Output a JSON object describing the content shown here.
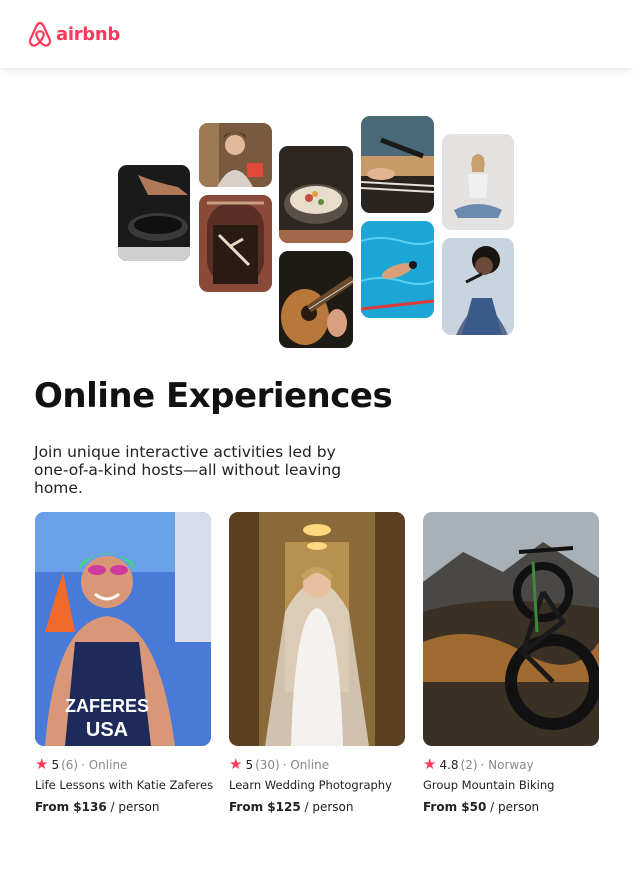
{
  "brand": {
    "name": "airbnb",
    "color": "#ff385c",
    "logo_icon": "airbnb-belo-icon"
  },
  "hero": {
    "heading": "Online Experiences",
    "subtitle": "Join unique interactive activities led by one-of-a-kind hosts—all without leaving home."
  },
  "gallery": [
    {
      "name": "cooking-pan-photo"
    },
    {
      "name": "woman-portrait-photo"
    },
    {
      "name": "dancer-doorway-photo"
    },
    {
      "name": "food-bowl-photo"
    },
    {
      "name": "guitar-photo"
    },
    {
      "name": "microphone-piano-photo"
    },
    {
      "name": "swimmer-pool-photo"
    },
    {
      "name": "yoga-photo"
    },
    {
      "name": "singer-photo"
    }
  ],
  "cards": [
    {
      "rating": "5",
      "reviews": "(6)",
      "location": "· Online",
      "title": "Life Lessons with Katie Zaferes",
      "price": "From $136",
      "unit": "/ person",
      "photo_text_line1": "ZAFERES",
      "photo_text_line2": "USA"
    },
    {
      "rating": "5",
      "reviews": "(30)",
      "location": "· Online",
      "title": "Learn Wedding Photography",
      "price": "From $125",
      "unit": "/ person"
    },
    {
      "rating": "4.8",
      "reviews": "(2)",
      "location": "· Norway",
      "title": "Group Mountain Biking",
      "price": "From $50",
      "unit": "/ person"
    }
  ],
  "colors": {
    "star": "#fe395c",
    "muted": "#888888",
    "text": "#222222"
  }
}
